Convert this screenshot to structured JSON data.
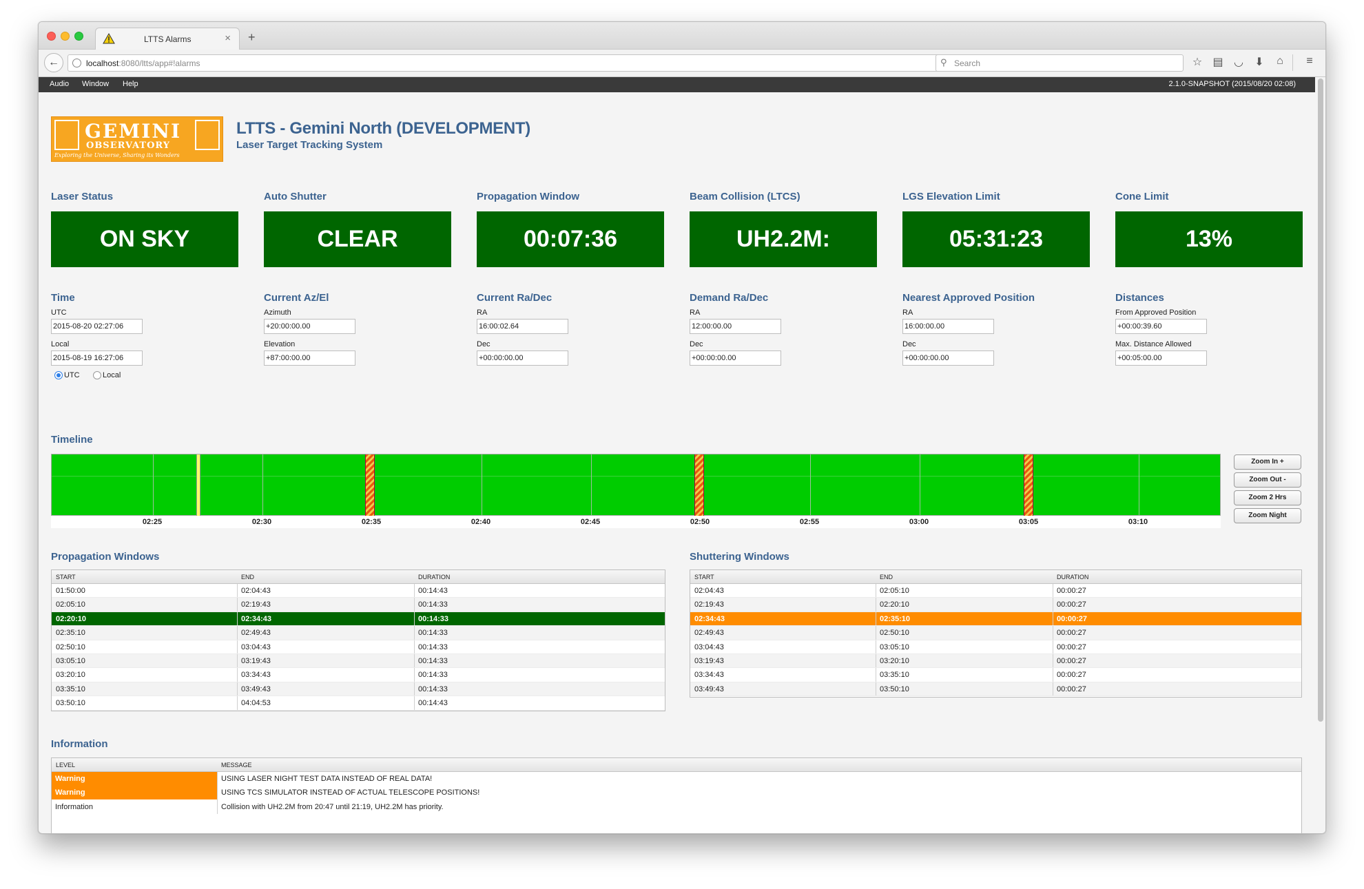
{
  "browser": {
    "tab_title": "LTTS Alarms",
    "url_host": "localhost",
    "url_rest": ":8080/ltts/app#!alarms",
    "search_placeholder": "Search"
  },
  "menu": {
    "items": [
      "Audio",
      "Window",
      "Help"
    ],
    "version": "2.1.0-SNAPSHOT (2015/08/20 02:08)"
  },
  "logo": {
    "word": "GEMINI",
    "sub": "OBSERVATORY",
    "tagline": "Exploring the Universe, Sharing its Wonders"
  },
  "header": {
    "title": "LTTS - Gemini North (DEVELOPMENT)",
    "subtitle": "Laser Target Tracking System"
  },
  "status": [
    {
      "label": "Laser Status",
      "value": "ON SKY"
    },
    {
      "label": "Auto Shutter",
      "value": "CLEAR"
    },
    {
      "label": "Propagation Window",
      "value": "00:07:36"
    },
    {
      "label": "Beam Collision (LTCS)",
      "value": "UH2.2M:"
    },
    {
      "label": "LGS Elevation Limit",
      "value": "05:31:23"
    },
    {
      "label": "Cone Limit",
      "value": "13%"
    }
  ],
  "time": {
    "title": "Time",
    "utc_label": "UTC",
    "utc_value": "2015-08-20 02:27:06",
    "local_label": "Local",
    "local_value": "2015-08-19 16:27:06",
    "radio_utc": "UTC",
    "radio_local": "Local"
  },
  "azel": {
    "title": "Current Az/El",
    "az_label": "Azimuth",
    "az_value": "+20:00:00.00",
    "el_label": "Elevation",
    "el_value": "+87:00:00.00"
  },
  "radec": {
    "title": "Current Ra/Dec",
    "ra_label": "RA",
    "ra_value": "16:00:02.64",
    "dec_label": "Dec",
    "dec_value": "+00:00:00.00"
  },
  "demand": {
    "title": "Demand Ra/Dec",
    "ra_label": "RA",
    "ra_value": "12:00:00.00",
    "dec_label": "Dec",
    "dec_value": "+00:00:00.00"
  },
  "nearest": {
    "title": "Nearest Approved Position",
    "ra_label": "RA",
    "ra_value": "16:00:00.00",
    "dec_label": "Dec",
    "dec_value": "+00:00:00.00"
  },
  "distances": {
    "title": "Distances",
    "from_label": "From Approved Position",
    "from_value": "+00:00:39.60",
    "max_label": "Max. Distance Allowed",
    "max_value": "+00:05:00.00"
  },
  "timeline": {
    "title": "Timeline",
    "ticks": [
      "02:25",
      "02:30",
      "02:35",
      "02:40",
      "02:45",
      "02:50",
      "02:55",
      "03:00",
      "03:05",
      "03:10"
    ],
    "zoom_in": "Zoom In +",
    "zoom_out": "Zoom Out -",
    "zoom_2h": "Zoom 2 Hrs",
    "zoom_night": "Zoom Night"
  },
  "propagation": {
    "title": "Propagation Windows",
    "headers": [
      "START",
      "END",
      "DURATION"
    ],
    "rows": [
      [
        "01:50:00",
        "02:04:43",
        "00:14:43"
      ],
      [
        "02:05:10",
        "02:19:43",
        "00:14:33"
      ],
      [
        "02:20:10",
        "02:34:43",
        "00:14:33"
      ],
      [
        "02:35:10",
        "02:49:43",
        "00:14:33"
      ],
      [
        "02:50:10",
        "03:04:43",
        "00:14:33"
      ],
      [
        "03:05:10",
        "03:19:43",
        "00:14:33"
      ],
      [
        "03:20:10",
        "03:34:43",
        "00:14:33"
      ],
      [
        "03:35:10",
        "03:49:43",
        "00:14:33"
      ],
      [
        "03:50:10",
        "04:04:53",
        "00:14:43"
      ]
    ],
    "selected": 2
  },
  "shuttering": {
    "title": "Shuttering Windows",
    "headers": [
      "START",
      "END",
      "DURATION"
    ],
    "rows": [
      [
        "02:04:43",
        "02:05:10",
        "00:00:27"
      ],
      [
        "02:19:43",
        "02:20:10",
        "00:00:27"
      ],
      [
        "02:34:43",
        "02:35:10",
        "00:00:27"
      ],
      [
        "02:49:43",
        "02:50:10",
        "00:00:27"
      ],
      [
        "03:04:43",
        "03:05:10",
        "00:00:27"
      ],
      [
        "03:19:43",
        "03:20:10",
        "00:00:27"
      ],
      [
        "03:34:43",
        "03:35:10",
        "00:00:27"
      ],
      [
        "03:49:43",
        "03:50:10",
        "00:00:27"
      ]
    ],
    "selected": 2
  },
  "information": {
    "title": "Information",
    "headers": [
      "LEVEL",
      "MESSAGE"
    ],
    "rows": [
      [
        "Warning",
        "USING LASER NIGHT TEST DATA INSTEAD OF REAL DATA!"
      ],
      [
        "Warning",
        "USING TCS SIMULATOR INSTEAD OF ACTUAL TELESCOPE POSITIONS!"
      ],
      [
        "Information",
        "Collision with UH2.2M from 20:47 until 21:19, UH2.2M has priority."
      ]
    ]
  },
  "colors": {
    "status_green": "#006600",
    "timeline_green": "#00cc00",
    "warning_orange": "#ff8c00",
    "heading_blue": "#3c6390"
  }
}
